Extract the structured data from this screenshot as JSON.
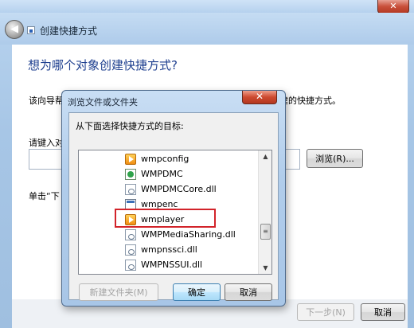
{
  "window": {
    "title": "创建快捷方式",
    "close_label": "✕",
    "back_label": "◀"
  },
  "wizard": {
    "heading": "想为哪个对象创建快捷方式?",
    "description_left": "该向导帮",
    "description_right": "建的快捷方式。",
    "type_label": "请键入对",
    "location_value": "",
    "browse_label": "浏览(R)...",
    "click_hint": "单击“下"
  },
  "footer": {
    "next_label": "下一步(N)",
    "cancel_label": "取消"
  },
  "browse_dialog": {
    "title": "浏览文件或文件夹",
    "close_label": "✕",
    "prompt": "从下面选择快捷方式的目标:",
    "items": [
      {
        "label": "wmpconfig",
        "icon": "media-player-icon"
      },
      {
        "label": "WMPDMC",
        "icon": "green-app-icon"
      },
      {
        "label": "WMPDMCCore.dll",
        "icon": "dll-file-icon"
      },
      {
        "label": "wmpenc",
        "icon": "app-window-icon"
      },
      {
        "label": "wmplayer",
        "icon": "media-player-icon"
      },
      {
        "label": "WMPMediaSharing.dll",
        "icon": "dll-file-icon"
      },
      {
        "label": "wmpnssci.dll",
        "icon": "dll-file-icon"
      },
      {
        "label": "WMPNSSUI.dll",
        "icon": "dll-file-icon"
      }
    ],
    "highlighted_item": "wmplayer",
    "new_folder_label": "新建文件夹(M)",
    "ok_label": "确定",
    "cancel_label": "取消",
    "scroll_up": "▲",
    "scroll_down": "▼",
    "scroll_thumb": "≡"
  },
  "colors": {
    "highlight": "#d2232a",
    "heading": "#1e3f8f",
    "aero_glass": "#b1cdeb"
  }
}
